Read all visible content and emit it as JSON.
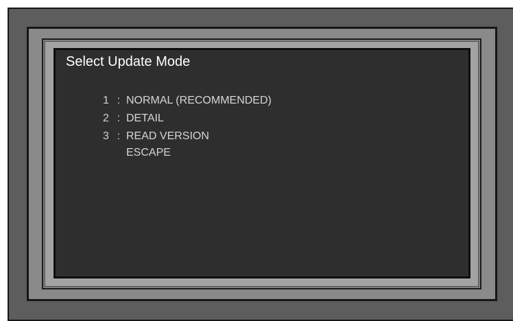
{
  "dialog": {
    "title": "Select Update Mode"
  },
  "menu": {
    "separator": ":",
    "items": [
      {
        "number": "1",
        "label": "NORMAL (RECOMMENDED)"
      },
      {
        "number": "2",
        "label": "DETAIL"
      },
      {
        "number": "3",
        "label": "READ VERSION"
      }
    ],
    "escape_label": "ESCAPE"
  }
}
